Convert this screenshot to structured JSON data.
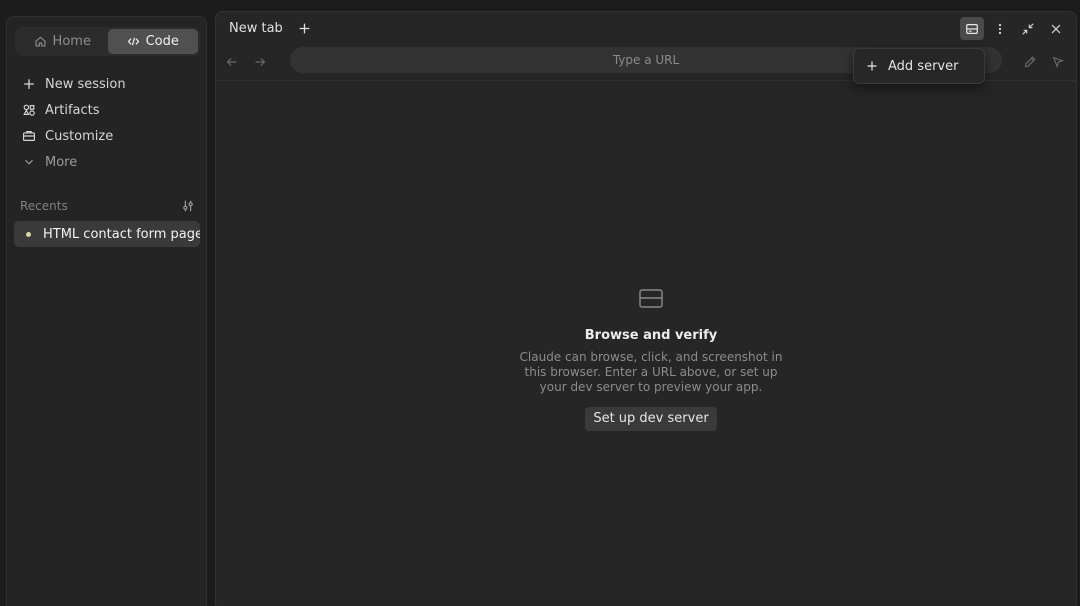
{
  "sidebar": {
    "segment": {
      "home_label": "Home",
      "code_label": "Code"
    },
    "nav": [
      {
        "label": "New session",
        "icon": "plus-icon"
      },
      {
        "label": "Artifacts",
        "icon": "artifacts-icon"
      },
      {
        "label": "Customize",
        "icon": "briefcase-icon"
      },
      {
        "label": "More",
        "icon": "chevron-down-icon"
      }
    ],
    "recents_label": "Recents",
    "recents": [
      {
        "label": "HTML contact form page"
      }
    ]
  },
  "browser": {
    "tab_title": "New tab",
    "url_placeholder": "Type a URL",
    "dropdown_label": "Add server"
  },
  "empty_state": {
    "title": "Browse and verify",
    "description": "Claude can browse, click, and screenshot in this browser. Enter a URL above, or set up your dev server to preview your app.",
    "button_label": "Set up dev server"
  },
  "colors": {
    "background": "#1c1c1c",
    "panel": "#262626",
    "active_segment": "#505050",
    "recent_dot": "#d9d9a8"
  }
}
